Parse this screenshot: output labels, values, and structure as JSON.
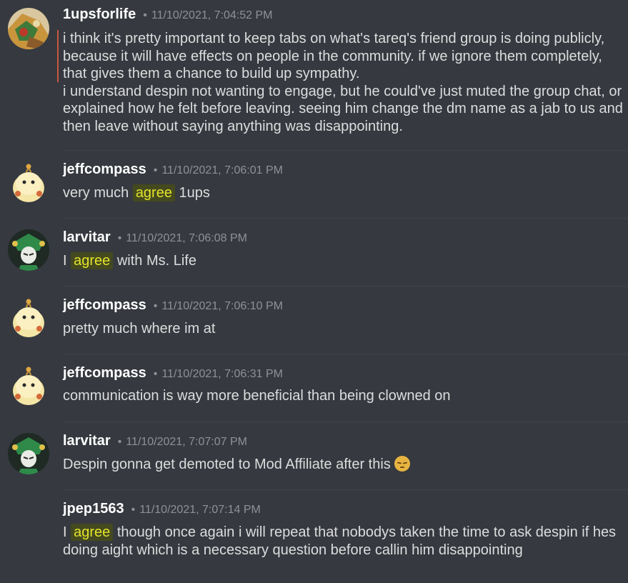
{
  "messages": [
    {
      "username": "1upsforlife",
      "timestamp": "11/10/2021, 7:04:52 PM",
      "lines": [
        "i think it's pretty important to keep tabs on what's tareq's friend group is doing publicly, because it will have effects on people in the community. if we ignore them completely, that gives them a chance to build up sympathy.",
        "i understand despin not wanting to engage, but he could've just muted the group chat, or explained how he felt before leaving. seeing him change the dm name as a jab to us and then leave without saying anything was disappointing."
      ]
    },
    {
      "username": "jeffcompass",
      "timestamp": "11/10/2021, 7:06:01 PM",
      "pre": "very much ",
      "highlight": "agree",
      "post": " 1ups"
    },
    {
      "username": "larvitar",
      "timestamp": "11/10/2021, 7:06:08 PM",
      "pre": "I ",
      "highlight": "agree",
      "post": " with Ms. Life"
    },
    {
      "username": "jeffcompass",
      "timestamp": "11/10/2021, 7:06:10 PM",
      "text": "pretty much where im at"
    },
    {
      "username": "jeffcompass",
      "timestamp": "11/10/2021, 7:06:31 PM",
      "text": "communication is way more beneficial than being clowned on"
    },
    {
      "username": "larvitar",
      "timestamp": "11/10/2021, 7:07:07 PM",
      "text": "Despin gonna get demoted to Mod Affiliate after this",
      "emoji": "pensive-face-emoji"
    },
    {
      "username": "jpep1563",
      "timestamp": "11/10/2021, 7:07:14 PM",
      "pre": "I ",
      "highlight": "agree",
      "post": " though once again i will repeat that nobodys taken the time to ask despin if hes doing aight which is a necessary question before callin him disappointing"
    }
  ],
  "separator": "•",
  "colors": {
    "background": "#36393f",
    "username": "#ffffff",
    "timestamp": "#8e9297",
    "text": "#dcddde",
    "highlight_bg": "#44491f",
    "highlight_text": "#e3e32b",
    "reply_bar": "#c8573e"
  }
}
